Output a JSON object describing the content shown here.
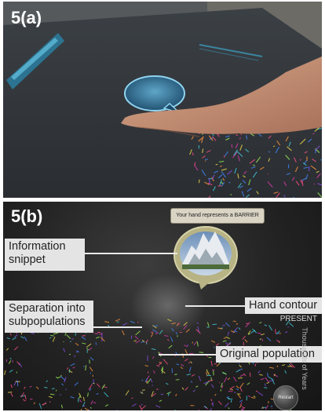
{
  "panel_a": {
    "tag": "5(a)"
  },
  "panel_b": {
    "tag": "5(b)",
    "banner_text": "Your hand represents a BARRIER",
    "labels": {
      "info_snippet": "Information snippet",
      "separation": "Separation into subpopulations",
      "hand_contour": "Hand contour",
      "original_population": "Original population"
    },
    "present_text": "PRESENT",
    "time_axis": "Thousands of Years",
    "restart": "Restart"
  },
  "colors": {
    "population_lines": [
      "#e84a7d",
      "#c93a9e",
      "#7f4bd6",
      "#3f7ee8",
      "#3fb9c8",
      "#8ddc55",
      "#e88a3a",
      "#d9c84a"
    ],
    "label_bg": "#e4e4e4"
  }
}
